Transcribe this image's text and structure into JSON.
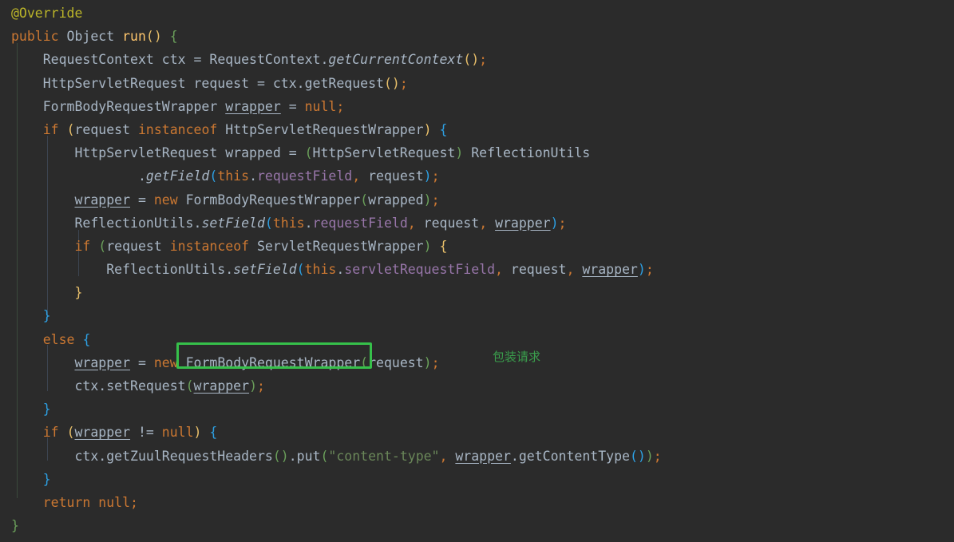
{
  "editor": {
    "theme": "darcula",
    "background": "#2B2B2B",
    "default_text_color": "#A9B7C6",
    "language": "java"
  },
  "code_lines": [
    {
      "indent": 0,
      "text": "@Override"
    },
    {
      "indent": 0,
      "text": "public Object run() {"
    },
    {
      "indent": 1,
      "text": "RequestContext ctx = RequestContext.getCurrentContext();"
    },
    {
      "indent": 1,
      "text": "HttpServletRequest request = ctx.getRequest();"
    },
    {
      "indent": 1,
      "text": "FormBodyRequestWrapper wrapper = null;"
    },
    {
      "indent": 1,
      "text": "if (request instanceof HttpServletRequestWrapper) {"
    },
    {
      "indent": 2,
      "text": "HttpServletRequest wrapped = (HttpServletRequest) ReflectionUtils"
    },
    {
      "indent": 4,
      "text": ".getField(this.requestField, request);"
    },
    {
      "indent": 2,
      "text": "wrapper = new FormBodyRequestWrapper(wrapped);"
    },
    {
      "indent": 2,
      "text": "ReflectionUtils.setField(this.requestField, request, wrapper);"
    },
    {
      "indent": 2,
      "text": "if (request instanceof ServletRequestWrapper) {"
    },
    {
      "indent": 3,
      "text": "ReflectionUtils.setField(this.servletRequestField, request, wrapper);"
    },
    {
      "indent": 2,
      "text": "}"
    },
    {
      "indent": 1,
      "text": "}"
    },
    {
      "indent": 1,
      "text": "else {"
    },
    {
      "indent": 2,
      "text": "wrapper = new FormBodyRequestWrapper(request);"
    },
    {
      "indent": 2,
      "text": "ctx.setRequest(wrapper);"
    },
    {
      "indent": 1,
      "text": "}"
    },
    {
      "indent": 1,
      "text": "if (wrapper != null) {"
    },
    {
      "indent": 2,
      "text": "ctx.getZuulRequestHeaders().put(\"content-type\", wrapper.getContentType());"
    },
    {
      "indent": 1,
      "text": "}"
    },
    {
      "indent": 1,
      "text": "return null;"
    },
    {
      "indent": 0,
      "text": "}"
    }
  ],
  "annotation": {
    "box_color": "#36C04A",
    "box_target_text": "FormBodyRequestWrapper(",
    "note_text": "包装请求",
    "note_color": "#3A9E4C"
  },
  "tokens": {
    "annotation_override": "@Override",
    "kw_public": "public",
    "type_object": "Object",
    "method_run": "run",
    "kw_if": "if",
    "kw_else": "else",
    "kw_new": "new",
    "kw_return": "return",
    "kw_null": "null",
    "kw_this": "this",
    "kw_instanceof": "instanceof",
    "string_content_type": "\"content-type\"",
    "var_wrapper": "wrapper",
    "var_request": "request",
    "var_ctx": "ctx",
    "var_wrapped": "wrapped",
    "field_requestField": "requestField",
    "field_servletRequestField": "servletRequestField",
    "class_RequestContext": "RequestContext",
    "class_HttpServletRequest": "HttpServletRequest",
    "class_HttpServletRequestWrapper": "HttpServletRequestWrapper",
    "class_ServletRequestWrapper": "ServletRequestWrapper",
    "class_FormBodyRequestWrapper": "FormBodyRequestWrapper",
    "class_ReflectionUtils": "ReflectionUtils",
    "m_getCurrentContext": "getCurrentContext",
    "m_getRequest": "getRequest",
    "m_getField": "getField",
    "m_setField": "setField",
    "m_setRequest": "setRequest",
    "m_getZuulRequestHeaders": "getZuulRequestHeaders",
    "m_put": "put",
    "m_getContentType": "getContentType"
  }
}
